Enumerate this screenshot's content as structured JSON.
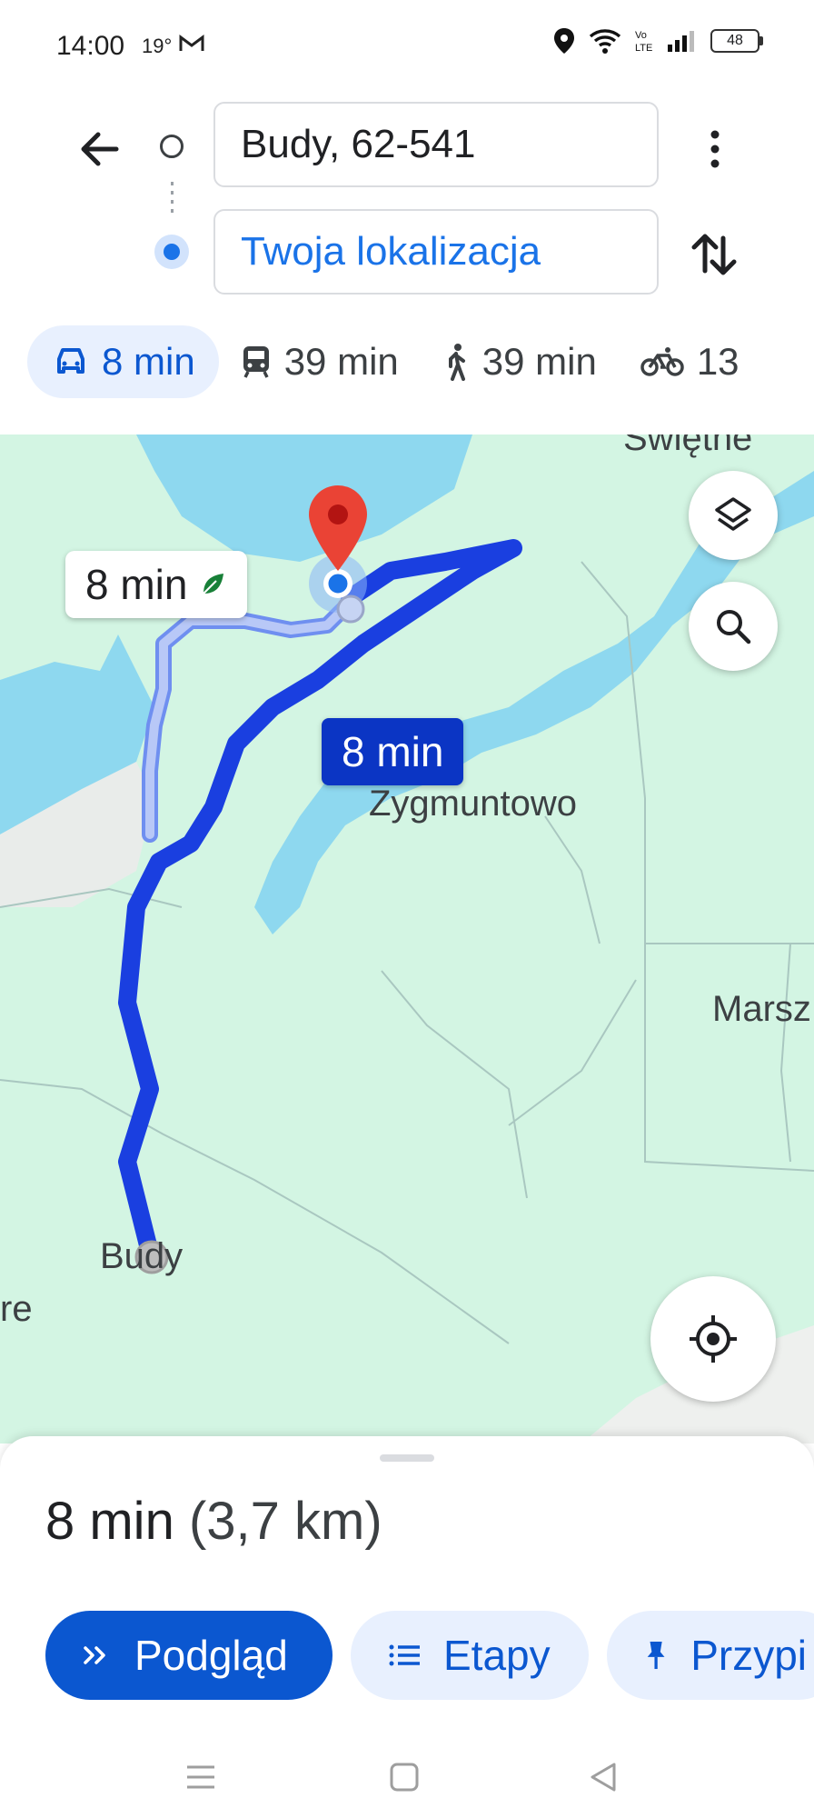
{
  "status": {
    "time": "14:00",
    "temperature": "19°",
    "battery": "48"
  },
  "route_inputs": {
    "origin_value": "Budy, 62-541",
    "destination_value": "Twoja lokalizacja"
  },
  "travel_modes": [
    {
      "icon": "car-icon",
      "label": "8 min",
      "active": true
    },
    {
      "icon": "transit-icon",
      "label": "39 min",
      "active": false
    },
    {
      "icon": "walk-icon",
      "label": "39 min",
      "active": false
    },
    {
      "icon": "bike-icon",
      "label": "13",
      "active": false
    }
  ],
  "map": {
    "labels": {
      "swietne": "Swiętne",
      "zygmuntowo": "Zygmuntowo",
      "marsz": "Marsz",
      "budy": "Budy",
      "re": "re"
    },
    "eco_route_time": "8 min",
    "main_route_time": "8 min",
    "colors": {
      "route_main": "#1a3fe0",
      "route_alt": "#aabff5",
      "water": "#8ed8ef",
      "land": "#d3f5e3",
      "pin": "#ea4335"
    }
  },
  "sheet": {
    "duration": "8 min",
    "distance": "(3,7 km)",
    "buttons": {
      "preview": "Podgląd",
      "steps": "Etapy",
      "pin": "Przypi"
    }
  }
}
